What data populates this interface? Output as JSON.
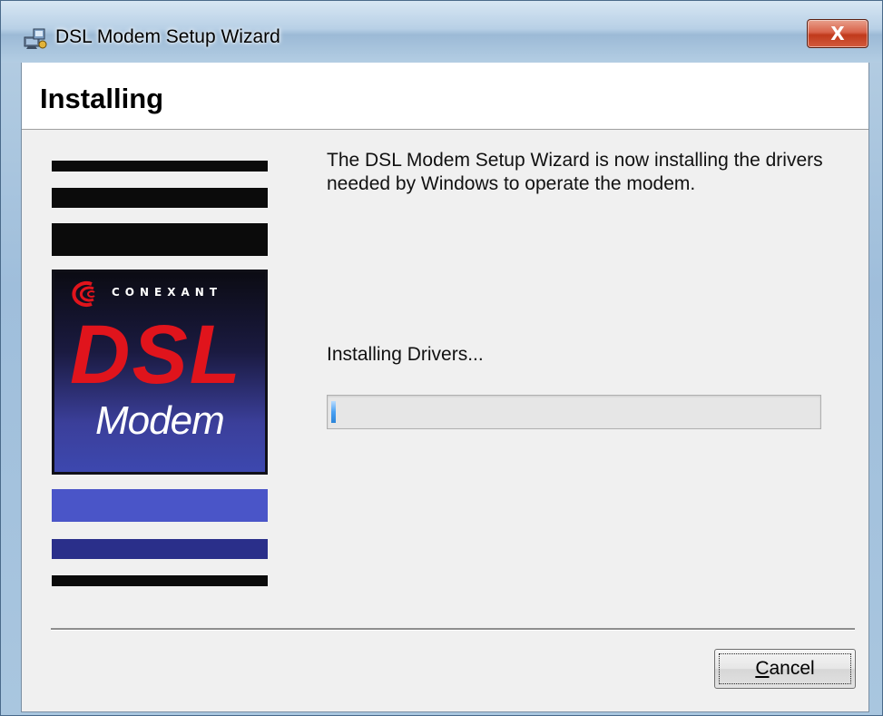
{
  "window": {
    "title": "DSL Modem Setup Wizard",
    "close_symbol": "X",
    "app_icon": "setup-wizard-icon"
  },
  "header": {
    "heading": "Installing"
  },
  "banner": {
    "brand": "CONEXANT",
    "product_line1": "DSL",
    "product_line2": "Modem",
    "colors": {
      "dark_bar": "#0b0b0b",
      "blue_bar": "#4a55c8",
      "navy_bar": "#2a2f8a",
      "dsl_red": "#e0141c"
    }
  },
  "main": {
    "message": "The DSL Modem Setup Wizard is now installing the drivers needed by Windows to operate the modem.",
    "status": "Installing Drivers...",
    "progress_fraction": 0.01
  },
  "footer": {
    "cancel_mnemonic": "C",
    "cancel_rest": "ancel"
  }
}
